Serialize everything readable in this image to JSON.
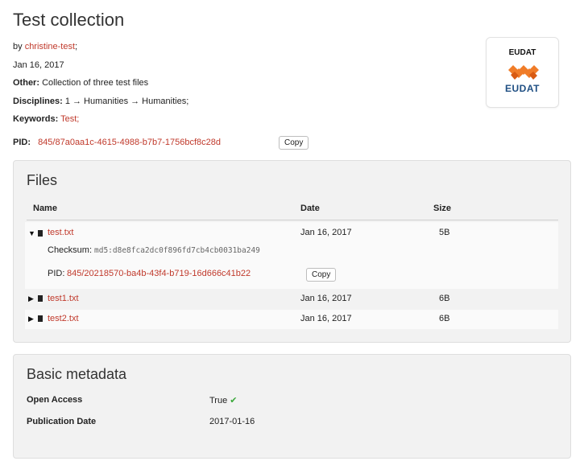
{
  "record": {
    "title": "Test collection",
    "by_label": "by",
    "author": "christine-test",
    "author_suffix": ";",
    "date": "Jan 16, 2017",
    "other_label": "Other:",
    "other_value": "Collection of three test files",
    "disciplines_label": "Disciplines:",
    "disciplines_value": "1 → Humanities → Humanities;",
    "keywords_label": "Keywords:",
    "keyword": "Test;",
    "pid_label": "PID:",
    "pid_value": "845/87a0aa1c-4615-4988-b7b7-1756bcf8c28d",
    "copy_label": "Copy"
  },
  "badge": {
    "top_text": "EUDAT",
    "logo_text": "EUDAT",
    "brand_color": "#1f4f83",
    "accent_color": "#f07c28"
  },
  "files": {
    "heading": "Files",
    "columns": {
      "name": "Name",
      "date": "Date",
      "size": "Size"
    },
    "rows": [
      {
        "name": "test.txt",
        "date": "Jan 16, 2017",
        "size": "5B",
        "expanded": true,
        "checksum_label": "Checksum:",
        "checksum": "md5:d8e8fca2dc0f896fd7cb4cb0031ba249",
        "pid_label": "PID:",
        "pid": "845/20218570-ba4b-43f4-b719-16d666c41b22",
        "copy_label": "Copy",
        "toggle_icon": "chevron-down-icon"
      },
      {
        "name": "test1.txt",
        "date": "Jan 16, 2017",
        "size": "6B",
        "expanded": false,
        "toggle_icon": "chevron-right-icon"
      },
      {
        "name": "test2.txt",
        "date": "Jan 16, 2017",
        "size": "6B",
        "expanded": false,
        "toggle_icon": "chevron-right-icon"
      }
    ]
  },
  "basic_metadata": {
    "heading": "Basic metadata",
    "open_access_label": "Open Access",
    "open_access_value": "True",
    "open_access_icon": "checkmark-icon",
    "publication_date_label": "Publication Date",
    "publication_date_value": "2017-01-16"
  },
  "colors": {
    "link": "#c0392b",
    "panel_bg": "#f2f2f2",
    "check": "#3aa83a"
  }
}
